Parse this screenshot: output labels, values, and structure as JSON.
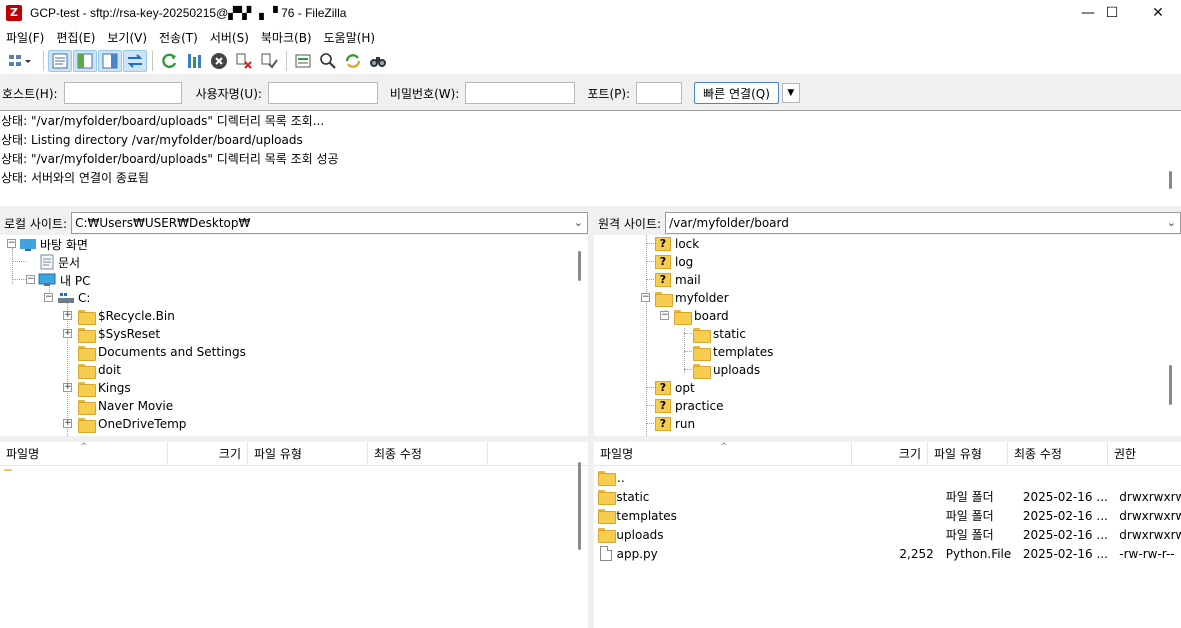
{
  "window": {
    "title": "GCP-test - sftp://rsa-key-20250215@▞▚▘ ▖▝ 76 - FileZilla"
  },
  "menu": [
    "파일(F)",
    "편집(E)",
    "보기(V)",
    "전송(T)",
    "서버(S)",
    "북마크(B)",
    "도움말(H)"
  ],
  "quickconnect": {
    "host_label": "호스트(H):",
    "user_label": "사용자명(U):",
    "pass_label": "비밀번호(W):",
    "port_label": "포트(P):",
    "connect_label": "빠른 연결(Q)",
    "host_value": "",
    "user_value": "",
    "pass_value": "",
    "port_value": ""
  },
  "log": [
    "상태: \"/var/myfolder/board/uploads\" 디렉터리 목록 조회...",
    "상태: Listing directory /var/myfolder/board/uploads",
    "상태: \"/var/myfolder/board/uploads\" 디렉터리 목록 조회 성공",
    "상태: 서버와의 연결이 종료됨"
  ],
  "local": {
    "label": "로컬 사이트:",
    "path": "C:₩Users₩USER₩Desktop₩",
    "tree": [
      {
        "name": "바탕 화면",
        "icon": "desktop-icon"
      },
      {
        "name": "문서",
        "icon": "document-icon"
      },
      {
        "name": "내 PC",
        "icon": "computer-icon"
      },
      {
        "name": "C:",
        "icon": "drive-icon"
      },
      {
        "name": "$Recycle.Bin",
        "icon": "folder-icon"
      },
      {
        "name": "$SysReset",
        "icon": "folder-icon"
      },
      {
        "name": "Documents and Settings",
        "icon": "folder-icon"
      },
      {
        "name": "doit",
        "icon": "folder-icon"
      },
      {
        "name": "Kings",
        "icon": "folder-icon"
      },
      {
        "name": "Naver Movie",
        "icon": "folder-icon"
      },
      {
        "name": "OneDriveTemp",
        "icon": "folder-icon"
      }
    ],
    "columns": [
      "파일명",
      "크기",
      "파일 유형",
      "최종 수정"
    ]
  },
  "remote": {
    "label": "원격 사이트:",
    "path": "/var/myfolder/board",
    "tree": [
      {
        "name": "lock",
        "icon": "unknown-folder-icon"
      },
      {
        "name": "log",
        "icon": "unknown-folder-icon"
      },
      {
        "name": "mail",
        "icon": "unknown-folder-icon"
      },
      {
        "name": "myfolder",
        "icon": "folder-icon"
      },
      {
        "name": "board",
        "icon": "folder-open-icon"
      },
      {
        "name": "static",
        "icon": "folder-icon"
      },
      {
        "name": "templates",
        "icon": "folder-icon"
      },
      {
        "name": "uploads",
        "icon": "folder-icon"
      },
      {
        "name": "opt",
        "icon": "unknown-folder-icon"
      },
      {
        "name": "practice",
        "icon": "unknown-folder-icon"
      },
      {
        "name": "run",
        "icon": "unknown-folder-icon"
      }
    ],
    "columns": [
      "파일명",
      "크기",
      "파일 유형",
      "최종 수정",
      "권한"
    ],
    "files": [
      {
        "name": "..",
        "size": "",
        "type": "",
        "modified": "",
        "perm": "",
        "icon": "folder-icon"
      },
      {
        "name": "static",
        "size": "",
        "type": "파일 폴더",
        "modified": "2025-02-16 ...",
        "perm": "drwxrwxrwx",
        "icon": "folder-icon"
      },
      {
        "name": "templates",
        "size": "",
        "type": "파일 폴더",
        "modified": "2025-02-16 ...",
        "perm": "drwxrwxrwx",
        "icon": "folder-icon"
      },
      {
        "name": "uploads",
        "size": "",
        "type": "파일 폴더",
        "modified": "2025-02-16 ...",
        "perm": "drwxrwxrwx",
        "icon": "folder-icon"
      },
      {
        "name": "app.py",
        "size": "2,252",
        "type": "Python.File",
        "modified": "2025-02-16 ...",
        "perm": "-rw-rw-r--",
        "icon": "file-icon"
      }
    ]
  }
}
